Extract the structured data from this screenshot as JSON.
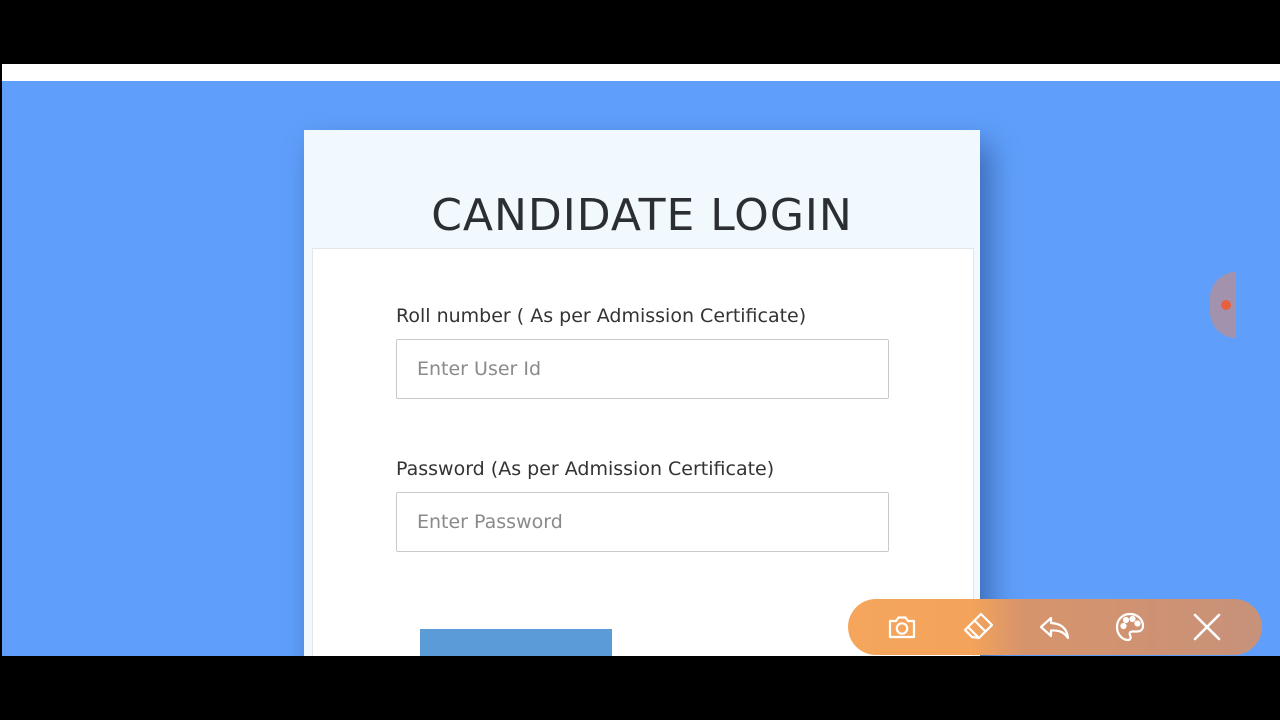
{
  "login": {
    "title": "CANDIDATE LOGIN",
    "roll_label": "Roll number ( As per Admission Certificate)",
    "roll_placeholder": "Enter User Id",
    "roll_value": "",
    "password_label": "Password (As per Admission Certificate)",
    "password_placeholder": "Enter Password",
    "password_value": "",
    "submit_label": ""
  },
  "toolbar": {
    "icons": [
      "camera-icon",
      "eraser-icon",
      "undo-icon",
      "palette-icon",
      "close-icon"
    ]
  },
  "colors": {
    "page_background": "#5f9ffb",
    "card_background": "#f1f9fe",
    "submit_button": "#5b9bd8",
    "toolbar_orange": "#f5a65c",
    "toolbar_muted": "#c7917a"
  }
}
